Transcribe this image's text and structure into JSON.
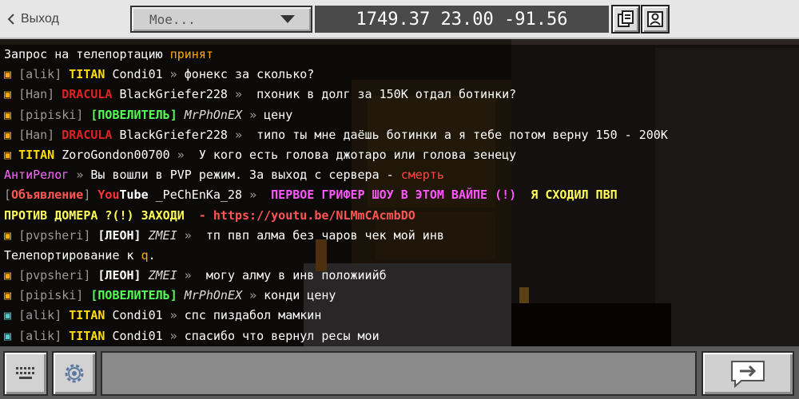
{
  "header": {
    "back_label": "Выход",
    "dropdown_value": "Мое...",
    "coordinates": "1749.37 23.00 -91.56"
  },
  "chat": {
    "lines": [
      [
        {
          "t": "Запрос на телепортацию ",
          "c": "#ffffff"
        },
        {
          "t": "принят",
          "c": "#ffaa00"
        }
      ],
      [
        {
          "t": "▣ ",
          "c": "#ffaa00"
        },
        {
          "t": "[alik] ",
          "c": "#9a9a9a"
        },
        {
          "t": "TITAN ",
          "c": "#ffdd00",
          "b": true
        },
        {
          "t": "Condi01 ",
          "c": "#ffffff"
        },
        {
          "t": "» ",
          "c": "#9a9a9a"
        },
        {
          "t": "фонекс за сколько?",
          "c": "#ffffff"
        }
      ],
      [
        {
          "t": "▣ ",
          "c": "#ffaa00"
        },
        {
          "t": "[Han] ",
          "c": "#9a9a9a"
        },
        {
          "t": "DRACULA ",
          "c": "#dd2222",
          "b": true
        },
        {
          "t": "BlackGriefer228 ",
          "c": "#ffffff"
        },
        {
          "t": "» ",
          "c": "#9a9a9a"
        },
        {
          "t": " пхоник в долг за 150К отдал ботинки?",
          "c": "#ffffff"
        }
      ],
      [
        {
          "t": "▣ ",
          "c": "#ffaa00"
        },
        {
          "t": "[pipiski] ",
          "c": "#9a9a9a"
        },
        {
          "t": "[ПОВЕЛИТЕЛЬ] ",
          "c": "#55ff55",
          "b": true
        },
        {
          "t": "MrPhOnEX ",
          "c": "#dddddd",
          "i": true
        },
        {
          "t": "» ",
          "c": "#9a9a9a"
        },
        {
          "t": "цену",
          "c": "#ffffff"
        }
      ],
      [
        {
          "t": "▣ ",
          "c": "#ffaa00"
        },
        {
          "t": "[Han] ",
          "c": "#9a9a9a"
        },
        {
          "t": "DRACULA ",
          "c": "#dd2222",
          "b": true
        },
        {
          "t": "BlackGriefer228 ",
          "c": "#ffffff"
        },
        {
          "t": "» ",
          "c": "#9a9a9a"
        },
        {
          "t": " типо ты мне даёшь ботинки а я тебе потом верну 150 - 200К",
          "c": "#ffffff"
        }
      ],
      [
        {
          "t": "▣ ",
          "c": "#ffaa00"
        },
        {
          "t": "TITAN ",
          "c": "#ffdd00",
          "b": true
        },
        {
          "t": "ZoroGondon00700 ",
          "c": "#ffffff"
        },
        {
          "t": "» ",
          "c": "#9a9a9a"
        },
        {
          "t": " У кого есть голова джотаро или голова зенецу",
          "c": "#ffffff"
        }
      ],
      [
        {
          "t": "АнтиРелог ",
          "c": "#ff66ff"
        },
        {
          "t": "» ",
          "c": "#9a9a9a"
        },
        {
          "t": "Вы вошли в PVP режим. За выход с сервера - ",
          "c": "#ffffff"
        },
        {
          "t": "смерть",
          "c": "#ff4444"
        }
      ],
      [
        {
          "t": "[",
          "c": "#9a9a9a"
        },
        {
          "t": "Объявление",
          "c": "#ff5555",
          "b": true
        },
        {
          "t": "] ",
          "c": "#9a9a9a"
        },
        {
          "t": "You",
          "c": "#ff3333",
          "b": true
        },
        {
          "t": "Tube ",
          "c": "#ffffff",
          "b": true
        },
        {
          "t": "_PeChEnKa_28 ",
          "c": "#ffffff"
        },
        {
          "t": "» ",
          "c": "#9a9a9a"
        },
        {
          "t": " ПЕРВОЕ ГРИФЕР ШОУ В ЭТОМ ВАЙПЕ (!)",
          "c": "#ff55ff",
          "b": true
        },
        {
          "t": "  Я СХОДИЛ ПВП",
          "c": "#ffff55",
          "b": true
        }
      ],
      [
        {
          "t": "ПРОТИВ ДОМЕРА ?(!) ЗАХОДИ",
          "c": "#ffff55",
          "b": true
        },
        {
          "t": "  - https://youtu.be/NLMmCAcmbDO",
          "c": "#ff5555",
          "b": true
        }
      ],
      [
        {
          "t": "▣ ",
          "c": "#ffaa00"
        },
        {
          "t": "[pvpsheri] ",
          "c": "#9a9a9a"
        },
        {
          "t": "[ЛЕОН] ",
          "c": "#ffffff",
          "b": true
        },
        {
          "t": "ZMEI ",
          "c": "#dddddd",
          "i": true
        },
        {
          "t": "» ",
          "c": "#9a9a9a"
        },
        {
          "t": " тп пвп алма без чаров чек мой инв",
          "c": "#ffffff"
        }
      ],
      [
        {
          "t": "Телепортирование к ",
          "c": "#ffffff"
        },
        {
          "t": "q",
          "c": "#ffaa00"
        },
        {
          "t": ".",
          "c": "#ffffff"
        }
      ],
      [
        {
          "t": "▣ ",
          "c": "#ffaa00"
        },
        {
          "t": "[pvpsheri] ",
          "c": "#9a9a9a"
        },
        {
          "t": "[ЛЕОН] ",
          "c": "#ffffff",
          "b": true
        },
        {
          "t": "ZMEI ",
          "c": "#dddddd",
          "i": true
        },
        {
          "t": "» ",
          "c": "#9a9a9a"
        },
        {
          "t": " могу алму в инв положиийб",
          "c": "#ffffff"
        }
      ],
      [
        {
          "t": "▣ ",
          "c": "#ffaa00"
        },
        {
          "t": "[pipiski] ",
          "c": "#9a9a9a"
        },
        {
          "t": "[ПОВЕЛИТЕЛЬ] ",
          "c": "#55ff55",
          "b": true
        },
        {
          "t": "MrPhOnEX ",
          "c": "#dddddd",
          "i": true
        },
        {
          "t": "» ",
          "c": "#9a9a9a"
        },
        {
          "t": "конди цену",
          "c": "#ffffff"
        }
      ],
      [
        {
          "t": "▣ ",
          "c": "#55cccc"
        },
        {
          "t": "[alik] ",
          "c": "#9a9a9a"
        },
        {
          "t": "TITAN ",
          "c": "#ffdd00",
          "b": true
        },
        {
          "t": "Condi01 ",
          "c": "#ffffff"
        },
        {
          "t": "» ",
          "c": "#9a9a9a"
        },
        {
          "t": "спс пиздабол мамкин",
          "c": "#ffffff"
        }
      ],
      [
        {
          "t": "▣ ",
          "c": "#55cccc"
        },
        {
          "t": "[alik] ",
          "c": "#9a9a9a"
        },
        {
          "t": "TITAN ",
          "c": "#ffdd00",
          "b": true
        },
        {
          "t": "Condi01 ",
          "c": "#ffffff"
        },
        {
          "t": "» ",
          "c": "#9a9a9a"
        },
        {
          "t": "спасибо что вернул ресы мои",
          "c": "#ffffff"
        }
      ]
    ]
  },
  "input": {
    "value": ""
  },
  "icons": {
    "back": "chevron-left-icon",
    "dropdown": "chevron-down-icon",
    "copy_coordinates": "copy-icon",
    "profile": "profile-card-icon",
    "keyboard": "keyboard-icon",
    "settings": "gear-icon",
    "send": "send-arrow-icon"
  }
}
